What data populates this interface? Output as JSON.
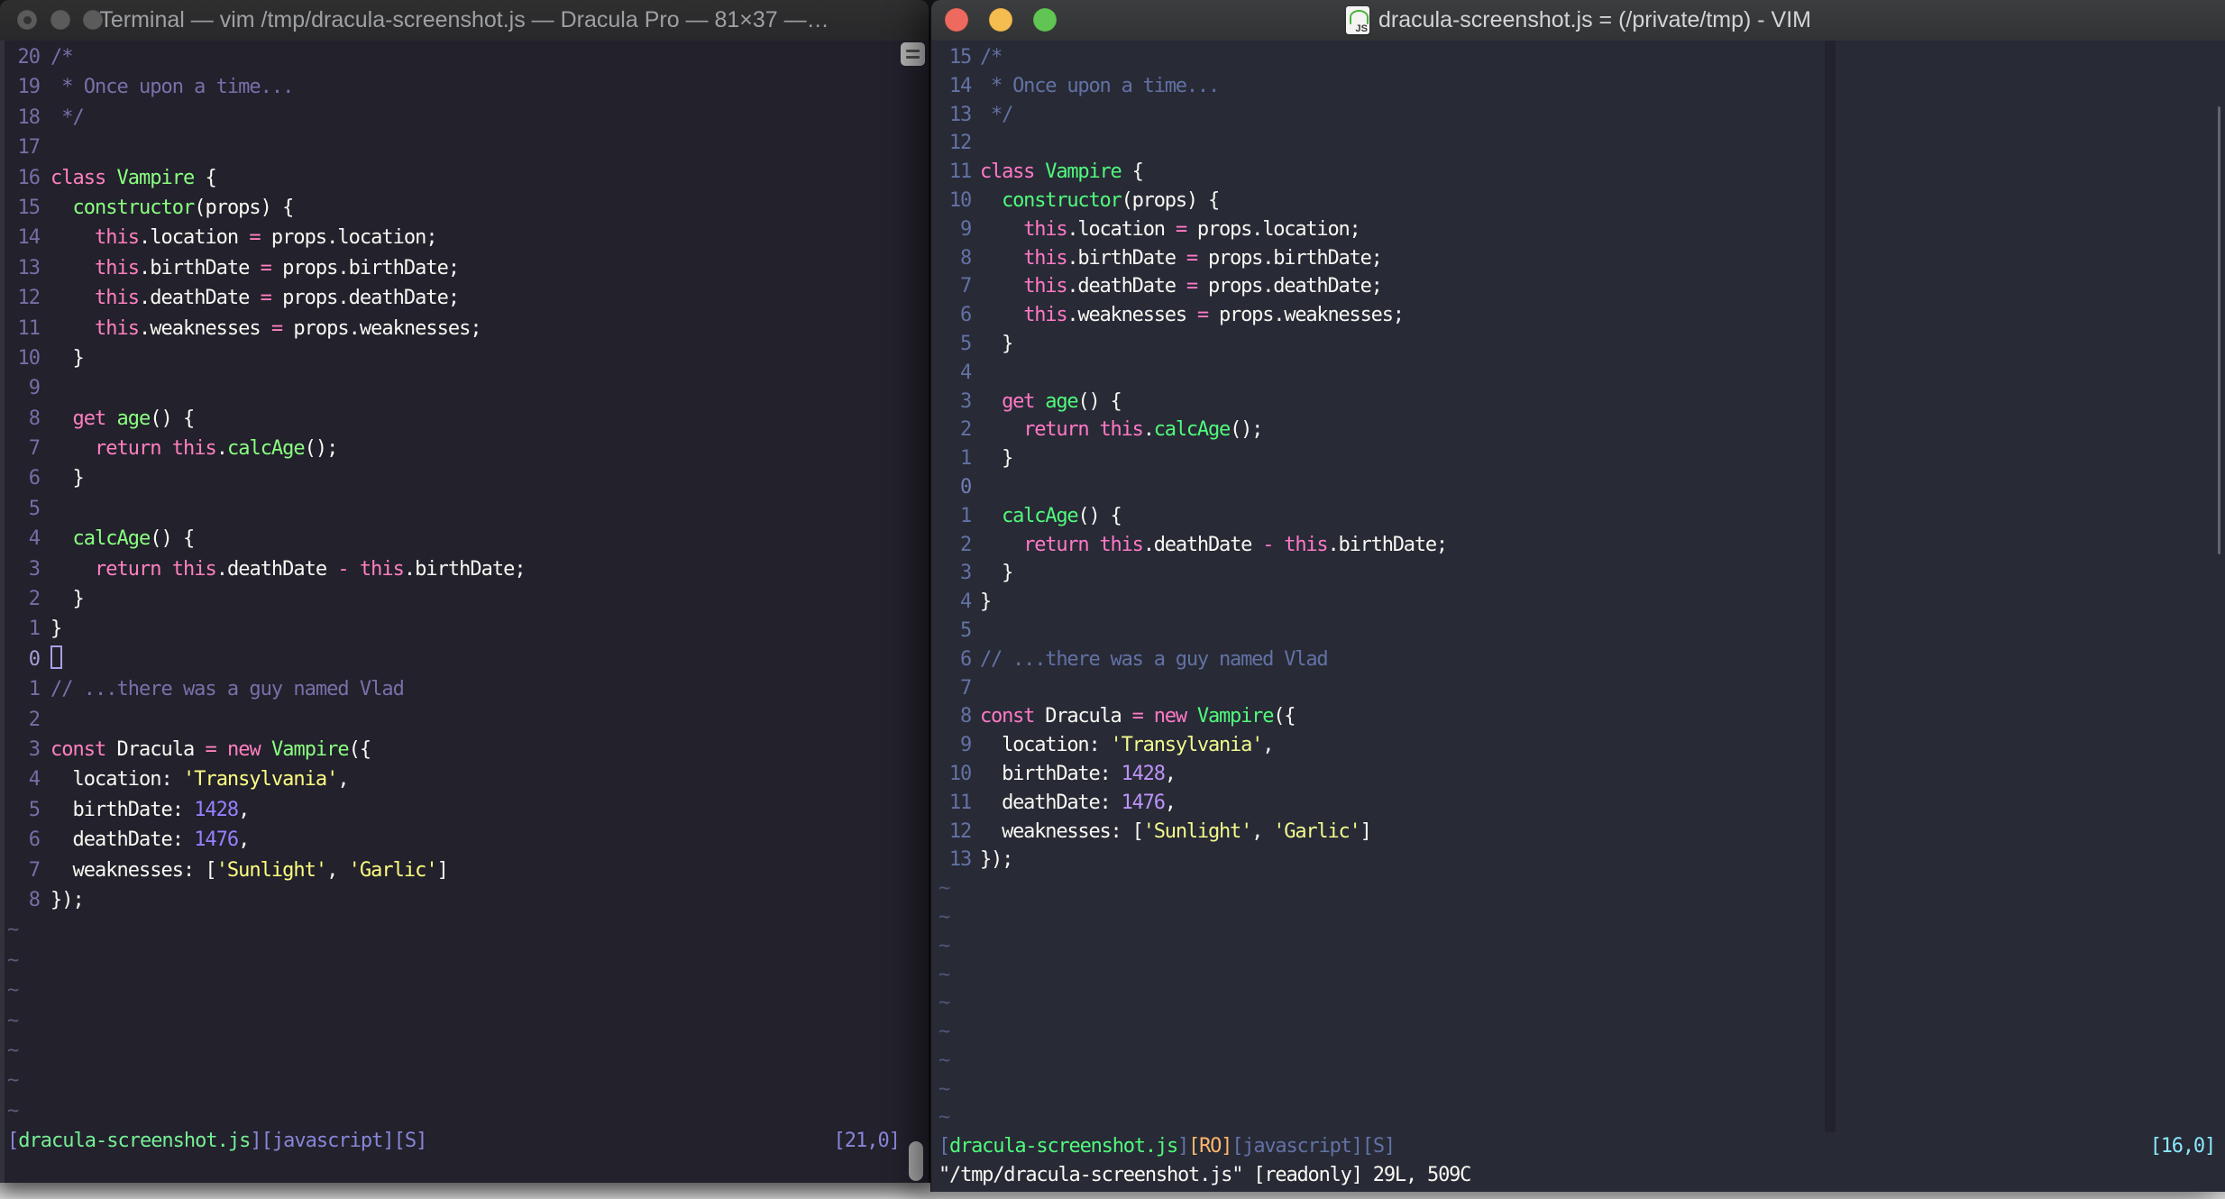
{
  "left_window": {
    "title": "Terminal — vim /tmp/dracula-screenshot.js — Dracula Pro — 81×37 —…",
    "theme_name": "Dracula Pro",
    "controls": {
      "close": "#5b5b5b",
      "minimize": "#5b5b5b",
      "zoom": "#5b5b5b"
    },
    "pane": {
      "rel_numbers": [
        "20",
        "19",
        "18",
        "17",
        "16",
        "15",
        "14",
        "13",
        "12",
        "11",
        "10",
        "9",
        "8",
        "7",
        "6",
        "5",
        "4",
        "3",
        "2",
        "1",
        "0",
        "1",
        "2",
        "3",
        "4",
        "5",
        "6",
        "7",
        "8"
      ],
      "cursor_row": 20,
      "cursor_style": "hollow",
      "tilde_count": 7,
      "status_left": [
        [
          "lav",
          "["
        ],
        [
          "grn",
          "dracula-screenshot.js"
        ],
        [
          "lav",
          "]"
        ],
        [
          "lav",
          "[javascript][S]"
        ]
      ],
      "status_right": [
        [
          "lav",
          "[21,0]"
        ]
      ],
      "palette": {
        "bg": "#22212C",
        "tk-f": "#F8F8F2",
        "tk-c": "#7970A9",
        "tk-p": "#FF80BF",
        "tk-g": "#8AFF80",
        "tk-y": "#FFFF80",
        "tk-n": "#9580FF",
        "lnum": "#756FA5",
        "cur-lnum": "#A79FD6",
        "tilde": "#5F5B7A",
        "tk-lav": "#8886D8",
        "tk-grn": "#76EF94",
        "cursor": "#A8A0E8"
      }
    }
  },
  "right_window": {
    "title": "dracula-screenshot.js = (/private/tmp) - VIM",
    "app_name": "VIM",
    "controls": {
      "close": "#EE6A5F",
      "minimize": "#F5BD4F",
      "zoom": "#61C554"
    },
    "pane": {
      "rel_numbers": [
        "15",
        "14",
        "13",
        "12",
        "11",
        "10",
        "9",
        "8",
        "7",
        "6",
        "5",
        "4",
        "3",
        "2",
        "1",
        "0",
        "1",
        "2",
        "3",
        "4",
        "5",
        "6",
        "7",
        "8",
        "9",
        "10",
        "11",
        "12",
        "13"
      ],
      "cursor_row": 15,
      "cursor_style": "none",
      "tilde_count": 9,
      "status_left": [
        [
          "slate",
          "["
        ],
        [
          "grn",
          "dracula-screenshot.js"
        ],
        [
          "slate",
          "]"
        ],
        [
          "org",
          "[RO]"
        ],
        [
          "slate",
          "[javascript][S]"
        ]
      ],
      "status_right": [
        [
          "cyn",
          "[16,0]"
        ]
      ],
      "command_line": "\"/tmp/dracula-screenshot.js\" [readonly] 29L, 509C",
      "palette": {
        "bg": "#282A36",
        "tk-f": "#F8F8F2",
        "tk-c": "#6272A4",
        "tk-p": "#FF79C6",
        "tk-g": "#50FA7B",
        "tk-y": "#F1FA8C",
        "tk-n": "#BD93F9",
        "lnum": "#6272A4",
        "cur-lnum": "#6F7FB4",
        "tilde": "#4E5878",
        "tk-slate": "#6272A4",
        "tk-grn": "#50FA7B",
        "tk-org": "#FFB86C",
        "tk-cyn": "#8BE9FD",
        "cursor": "#F8F8F2",
        "colorcolumn": "#21222C"
      }
    }
  },
  "code": {
    "tilde": "~",
    "segments": [
      [
        [
          "c",
          "/*"
        ]
      ],
      [
        [
          "c",
          " * Once upon a time..."
        ]
      ],
      [
        [
          "c",
          " */"
        ]
      ],
      [],
      [
        [
          "p",
          "class"
        ],
        [
          "f",
          " "
        ],
        [
          "g",
          "Vampire"
        ],
        [
          "f",
          " {"
        ]
      ],
      [
        [
          "f",
          "  "
        ],
        [
          "g",
          "constructor"
        ],
        [
          "f",
          "(props) {"
        ]
      ],
      [
        [
          "f",
          "    "
        ],
        [
          "p",
          "this"
        ],
        [
          "f",
          ".location "
        ],
        [
          "p",
          "="
        ],
        [
          "f",
          " props.location;"
        ]
      ],
      [
        [
          "f",
          "    "
        ],
        [
          "p",
          "this"
        ],
        [
          "f",
          ".birthDate "
        ],
        [
          "p",
          "="
        ],
        [
          "f",
          " props.birthDate;"
        ]
      ],
      [
        [
          "f",
          "    "
        ],
        [
          "p",
          "this"
        ],
        [
          "f",
          ".deathDate "
        ],
        [
          "p",
          "="
        ],
        [
          "f",
          " props.deathDate;"
        ]
      ],
      [
        [
          "f",
          "    "
        ],
        [
          "p",
          "this"
        ],
        [
          "f",
          ".weaknesses "
        ],
        [
          "p",
          "="
        ],
        [
          "f",
          " props.weaknesses;"
        ]
      ],
      [
        [
          "f",
          "  }"
        ]
      ],
      [],
      [
        [
          "f",
          "  "
        ],
        [
          "p",
          "get"
        ],
        [
          "f",
          " "
        ],
        [
          "g",
          "age"
        ],
        [
          "f",
          "() {"
        ]
      ],
      [
        [
          "f",
          "    "
        ],
        [
          "p",
          "return"
        ],
        [
          "f",
          " "
        ],
        [
          "p",
          "this"
        ],
        [
          "f",
          "."
        ],
        [
          "g",
          "calcAge"
        ],
        [
          "f",
          "();"
        ]
      ],
      [
        [
          "f",
          "  }"
        ]
      ],
      [],
      [
        [
          "f",
          "  "
        ],
        [
          "g",
          "calcAge"
        ],
        [
          "f",
          "() {"
        ]
      ],
      [
        [
          "f",
          "    "
        ],
        [
          "p",
          "return"
        ],
        [
          "f",
          " "
        ],
        [
          "p",
          "this"
        ],
        [
          "f",
          ".deathDate "
        ],
        [
          "p",
          "-"
        ],
        [
          "f",
          " "
        ],
        [
          "p",
          "this"
        ],
        [
          "f",
          ".birthDate;"
        ]
      ],
      [
        [
          "f",
          "  }"
        ]
      ],
      [
        [
          "f",
          "}"
        ]
      ],
      [],
      [
        [
          "c",
          "// ...there was a guy named Vlad"
        ]
      ],
      [],
      [
        [
          "p",
          "const"
        ],
        [
          "f",
          " Dracula "
        ],
        [
          "p",
          "="
        ],
        [
          "f",
          " "
        ],
        [
          "p",
          "new"
        ],
        [
          "f",
          " "
        ],
        [
          "g",
          "Vampire"
        ],
        [
          "f",
          "({"
        ]
      ],
      [
        [
          "f",
          "  location: "
        ],
        [
          "y",
          "'Transylvania'"
        ],
        [
          "f",
          ","
        ]
      ],
      [
        [
          "f",
          "  birthDate: "
        ],
        [
          "n",
          "1428"
        ],
        [
          "f",
          ","
        ]
      ],
      [
        [
          "f",
          "  deathDate: "
        ],
        [
          "n",
          "1476"
        ],
        [
          "f",
          ","
        ]
      ],
      [
        [
          "f",
          "  weaknesses: ["
        ],
        [
          "y",
          "'Sunlight'"
        ],
        [
          "f",
          ", "
        ],
        [
          "y",
          "'Garlic'"
        ],
        [
          "f",
          "]"
        ]
      ],
      [
        [
          "f",
          "});"
        ]
      ]
    ]
  }
}
